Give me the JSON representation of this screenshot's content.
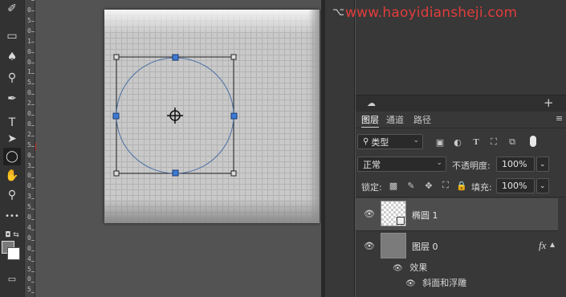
{
  "watermark": "www.haoyidiansheji.com",
  "ruler_vertical": [
    "0",
    "5",
    "0",
    "1",
    "0",
    "0",
    "1",
    "5",
    "0",
    "2",
    "0",
    "0",
    "2",
    "5",
    "0",
    "3",
    "0",
    "0",
    "3",
    "5",
    "0",
    "4",
    "0",
    "0",
    "4",
    "5",
    "0",
    "5"
  ],
  "tools": [
    {
      "name": "eraser-icon",
      "glyph": "✐"
    },
    {
      "name": "gradient-icon",
      "glyph": "▦"
    },
    {
      "name": "blur-icon",
      "glyph": "💧"
    },
    {
      "name": "dodge-icon",
      "glyph": "🔍"
    },
    {
      "name": "pen-icon",
      "glyph": "✒"
    },
    {
      "name": "type-icon",
      "glyph": "T"
    },
    {
      "name": "path-select-icon",
      "glyph": "➤"
    },
    {
      "name": "ellipse-tool-icon",
      "glyph": "◯"
    },
    {
      "name": "hand-icon",
      "glyph": "✋"
    },
    {
      "name": "zoom-icon",
      "glyph": "🔍"
    },
    {
      "name": "more-tools-icon",
      "glyph": "•••"
    }
  ],
  "accent_red": "#e23c3c",
  "layers_panel": {
    "tabs": [
      "图层",
      "通道",
      "路径"
    ],
    "active_tab": "图层",
    "filter_kind": "类型",
    "blend_mode": "正常",
    "opacity_label": "不透明度:",
    "opacity_value": "100%",
    "lock_label": "锁定:",
    "fill_label": "填充:",
    "fill_value": "100%",
    "layers": [
      {
        "name": "椭圆 1",
        "selected": true
      },
      {
        "name": "图层 0",
        "selected": false,
        "fx": "fx"
      }
    ],
    "effects_label": "效果",
    "effect_item": "斜面和浮雕"
  }
}
